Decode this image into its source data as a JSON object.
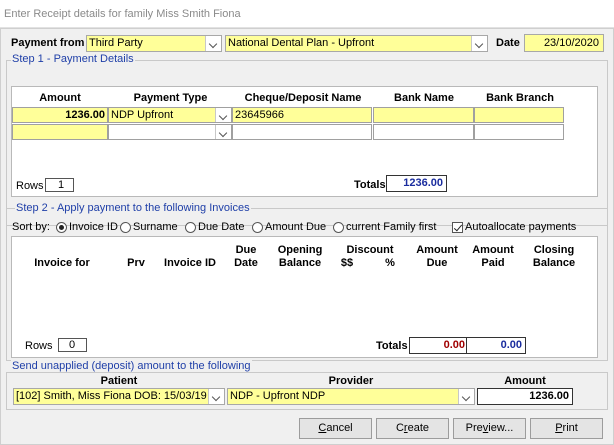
{
  "window": {
    "title": "Enter Receipt details for family Miss  Smith  Fiona"
  },
  "header": {
    "payment_from_label": "Payment from",
    "payment_from_value": "Third Party",
    "plan_value": "National Dental Plan - Upfront",
    "date_label": "Date",
    "date_value": "23/10/2020"
  },
  "step1": {
    "title": "Step 1 - Payment Details",
    "columns": [
      "Amount",
      "Payment Type",
      "Cheque/Deposit Name",
      "Bank Name",
      "Bank Branch"
    ],
    "rows": [
      {
        "amount": "1236.00",
        "payment_type": "NDP Upfront",
        "cheque_name": "23645966",
        "bank_name": "",
        "bank_branch": ""
      },
      {
        "amount": "",
        "payment_type": "",
        "cheque_name": "",
        "bank_name": "",
        "bank_branch": ""
      }
    ],
    "rows_label": "Rows",
    "rows_count": "1",
    "totals_label": "Totals",
    "totals_value": "1236.00"
  },
  "step2": {
    "title": "Step 2 - Apply payment to the following Invoices",
    "sort_by_label": "Sort by:",
    "sort_options": [
      "Invoice ID",
      "Surname",
      "Due Date",
      "Amount Due",
      "current Family first"
    ],
    "autoallocate_label": "Autoallocate payments",
    "columns": {
      "invoice_for": "Invoice for",
      "prv": "Prv",
      "invoice_id": "Invoice ID",
      "due_date_1": "Due",
      "due_date_2": "Date",
      "opening_1": "Opening",
      "opening_2": "Balance",
      "discount": "Discount",
      "discount_dollar": "$$",
      "discount_pct": "%",
      "amount_due_1": "Amount",
      "amount_due_2": "Due",
      "amount_paid_1": "Amount",
      "amount_paid_2": "Paid",
      "closing_1": "Closing",
      "closing_2": "Balance"
    },
    "rows_label": "Rows",
    "rows_count": "0",
    "totals_label": "Totals",
    "total_due": "0.00",
    "total_paid": "0.00",
    "due_color": "#a00000",
    "paid_color": "#1a2c9e"
  },
  "unapplied": {
    "title": "Send unapplied (deposit) amount to the following",
    "patient_label": "Patient",
    "provider_label": "Provider",
    "amount_label": "Amount",
    "patient_value": "[102] Smith, Miss Fiona DOB: 15/03/19",
    "provider_value": "NDP - Upfront NDP",
    "amount_value": "1236.00"
  },
  "buttons": {
    "cancel_pre": "",
    "cancel_u": "C",
    "cancel_post": "ancel",
    "create_pre": "C",
    "create_u": "r",
    "create_post": "eate",
    "preview_pre": "Pre",
    "preview_u": "v",
    "preview_post": "iew...",
    "print_pre": "",
    "print_u": "P",
    "print_post": "rint"
  },
  "colors": {
    "field_yellow": "#ffff99",
    "group_title_blue": "#1f3fa8"
  }
}
